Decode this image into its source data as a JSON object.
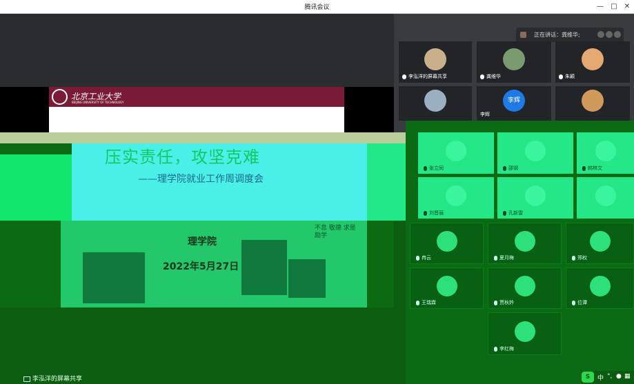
{
  "window": {
    "title": "腾讯会议",
    "controls": [
      "minimize-icon",
      "maximize-icon",
      "close-icon"
    ]
  },
  "slide": {
    "university_name": "北京工业大学",
    "university_name_en": "BEIJING UNIVERSITY OF TECHNOLOGY",
    "title": "压实责任，攻坚克难",
    "subtitle": "——理学院就业工作周调度会",
    "department": "理学院",
    "date": "2022年5月27日",
    "calligraphy": "不息 敬德 求是 励学"
  },
  "share_indicator": {
    "label": "李泓洋的屏幕共享"
  },
  "speaking_bar": {
    "label": "正在讲话：龚维华;"
  },
  "video_tiles": [
    {
      "name": "李泓洋的屏幕共享",
      "avatar_color": "#c9b08a"
    },
    {
      "name": "龚维华",
      "avatar_color": "#7a9a70"
    },
    {
      "name": "朱颖",
      "avatar_color": "#e5a870"
    },
    {
      "name": "",
      "avatar_color": "#9ab0c0"
    },
    {
      "name": "李辉",
      "avatar_text": "李辉",
      "avatar_color": "#1e7ae6"
    },
    {
      "name": "",
      "avatar_color": "#d09a5a"
    }
  ],
  "green_tiles": [
    {
      "name": "张立同"
    },
    {
      "name": "邵钢"
    },
    {
      "name": "韩林文"
    },
    {
      "name": "刘晋丽"
    },
    {
      "name": "孔新雷"
    },
    {
      "name": ""
    }
  ],
  "dark_tiles": [
    {
      "name": "冉云"
    },
    {
      "name": "夏月梅"
    },
    {
      "name": "郑权"
    },
    {
      "name": "王瑞霖"
    },
    {
      "name": "贾秋妗"
    },
    {
      "name": "位谭"
    },
    {
      "name": "李红梅"
    }
  ],
  "tray": {
    "ime": "中",
    "icons": [
      "punctuation-icon",
      "mic-icon",
      "keyboard-icon"
    ]
  }
}
